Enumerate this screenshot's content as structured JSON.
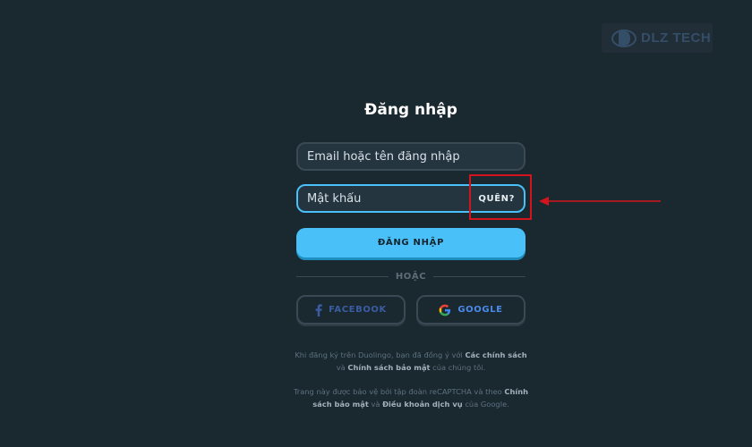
{
  "watermark": {
    "text": "DLZ TECH"
  },
  "title": "Đăng nhập",
  "email_field": {
    "placeholder": "Email hoặc tên đăng nhập"
  },
  "password_field": {
    "placeholder": "Mật khẩu",
    "forgot_label": "QUÊN?"
  },
  "login_button": {
    "label": "ĐĂNG NHẬP"
  },
  "divider": {
    "label": "HOẶC"
  },
  "social": {
    "facebook_label": "FACEBOOK",
    "google_label": "GOOGLE"
  },
  "legal": {
    "terms_prefix": "Khi đăng ký trên Duolingo, bạn đã đồng ý với",
    "terms_link_1": "Các chính sách",
    "terms_connector": "và",
    "terms_link_2": "Chính sách bảo mật",
    "terms_suffix": "của chúng tôi.",
    "captcha_prefix": "Trang này được bảo vệ bởi tập đoàn reCAPTCHA và theo",
    "captcha_link_1": "Chính sách bảo mật",
    "captcha_connector": "và",
    "captcha_link_2": "Điều khoản dịch vụ",
    "captcha_suffix": "của Google."
  },
  "colors": {
    "background": "#1a2830",
    "accent": "#49c0f8",
    "annotation_red": "#d4141c",
    "facebook_blue": "#3b5ca3",
    "google_blue": "#4a8ae8"
  }
}
